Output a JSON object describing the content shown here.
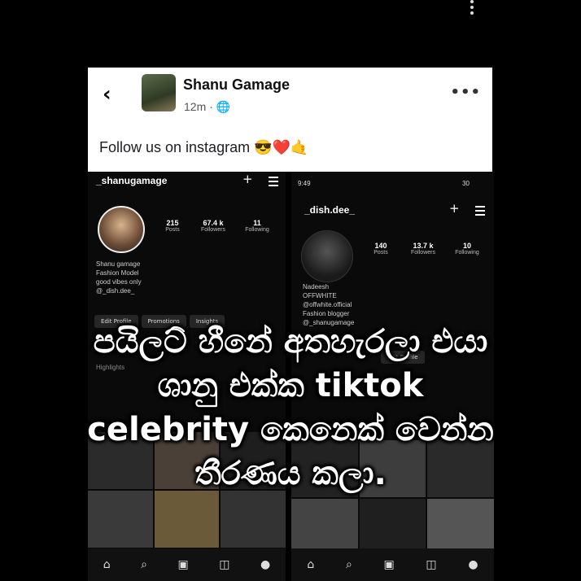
{
  "post": {
    "author": "Shanu Gamage",
    "time": "12m",
    "text": "Follow us on instagram",
    "emojis": "😎❤️🤙",
    "back_icon": "‹",
    "more_icon": "•••"
  },
  "left_profile": {
    "username": "_shanugamage",
    "stats": [
      {
        "value": "215",
        "label": "Posts"
      },
      {
        "value": "67.4 k",
        "label": "Followers"
      },
      {
        "value": "11",
        "label": "Following"
      }
    ],
    "bio": [
      "Shanu gamage",
      "Fashion Model",
      "good vibes only",
      "@_dish.dee_"
    ],
    "buttons": [
      "Edit Profile",
      "Promotions",
      "Insights"
    ],
    "highlights_label": "Highlights"
  },
  "right_profile": {
    "status_time": "9:49",
    "status_right": "30",
    "username": "_dish.dee_",
    "stats": [
      {
        "value": "140",
        "label": "Posts"
      },
      {
        "value": "13.7 k",
        "label": "Followers"
      },
      {
        "value": "10",
        "label": "Following"
      }
    ],
    "bio": [
      "Nadeesh",
      "OFFWHITE",
      "@offwhite.official",
      "Fashion blogger",
      "@_shanugamage"
    ],
    "buttons": [
      "Edit Profile"
    ]
  },
  "caption": {
    "line1": "පයිලට් හීනේ අතහැරලා එයා",
    "line2": "ශානු එක්ක tiktok",
    "line3": "celebrity කෙනෙක් වෙන්න",
    "line4": "තීරණය කලා."
  },
  "colors": {
    "background": "#000000",
    "card": "#ffffff",
    "ig_bg": "#0a0a0a"
  }
}
